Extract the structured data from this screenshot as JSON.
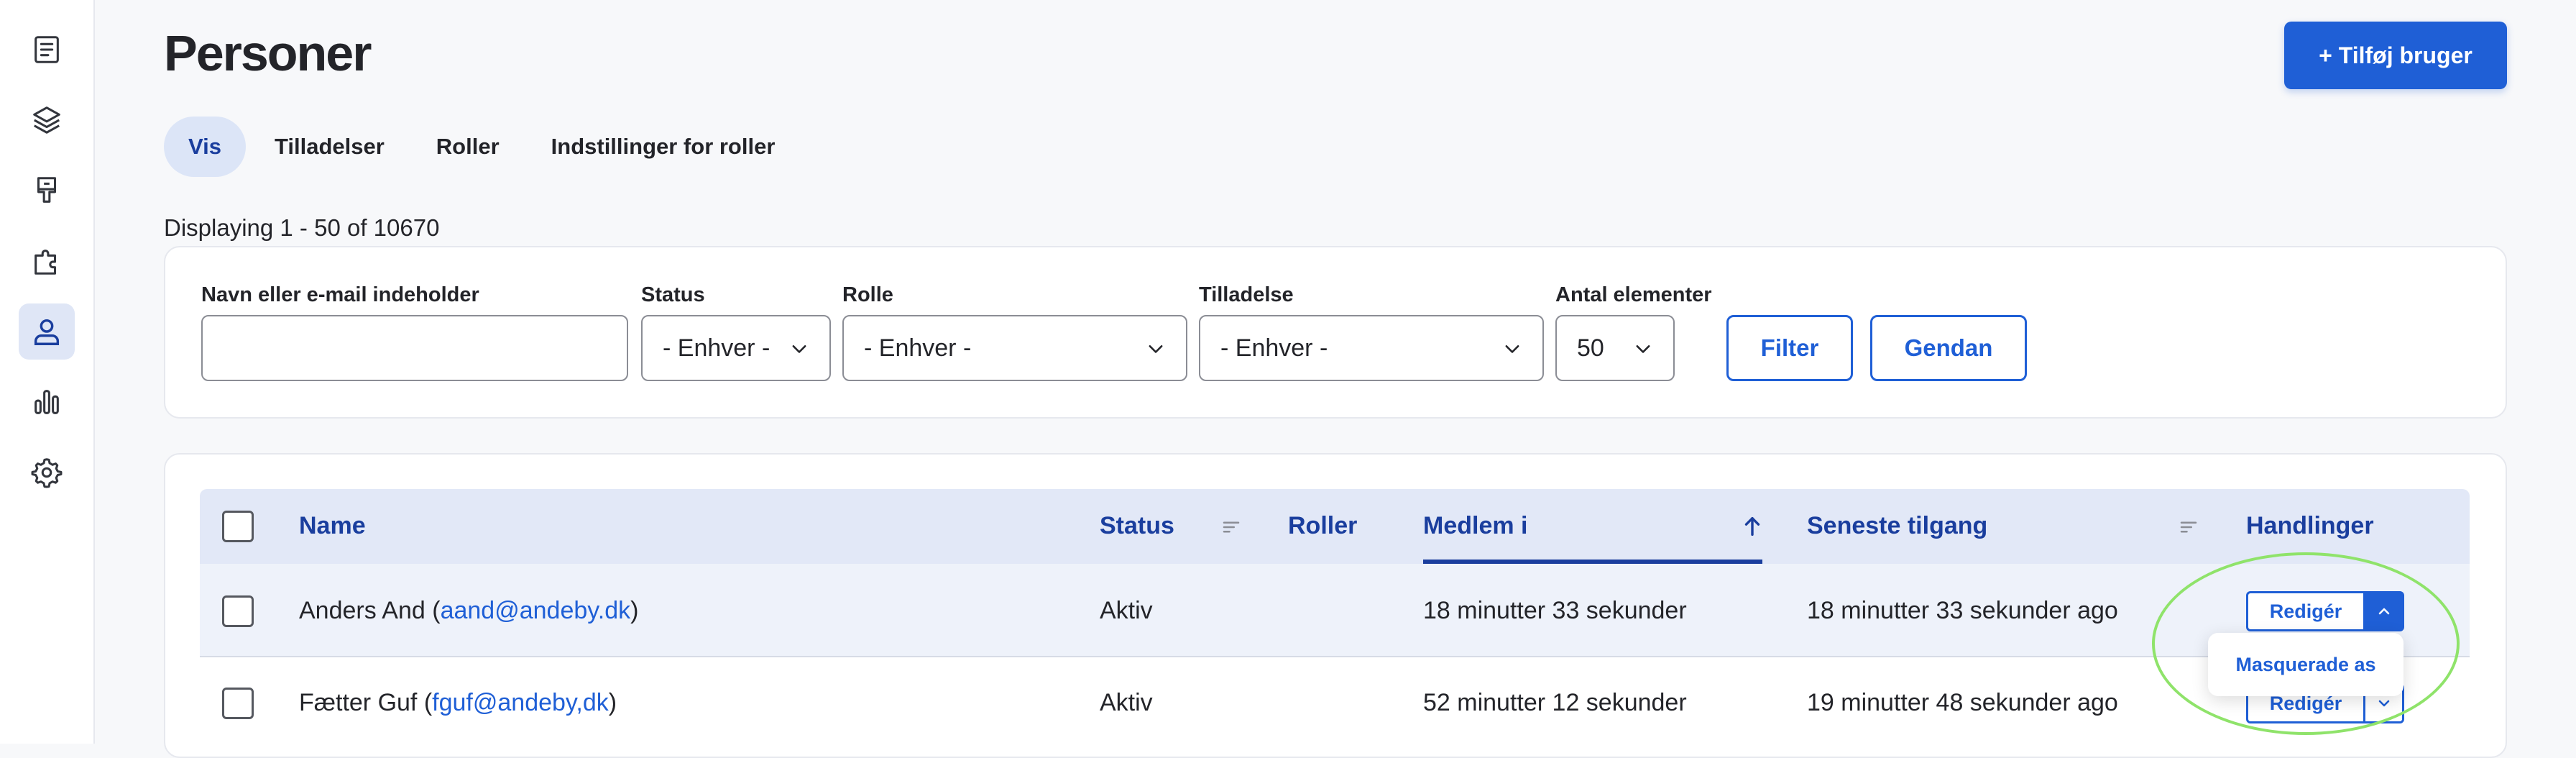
{
  "sidebar": {
    "items": [
      {
        "icon": "document-icon",
        "active": false
      },
      {
        "icon": "layers-icon",
        "active": false
      },
      {
        "icon": "brush-icon",
        "active": false
      },
      {
        "icon": "puzzle-icon",
        "active": false
      },
      {
        "icon": "user-icon",
        "active": true
      },
      {
        "icon": "bar-chart-icon",
        "active": false
      },
      {
        "icon": "gear-icon",
        "active": false
      }
    ]
  },
  "header": {
    "title": "Personer",
    "add_user_label": "+ Tilføj bruger"
  },
  "tabs": [
    {
      "label": "Vis",
      "active": true
    },
    {
      "label": "Tilladelser",
      "active": false
    },
    {
      "label": "Roller",
      "active": false
    },
    {
      "label": "Indstillinger for roller",
      "active": false
    }
  ],
  "displaying": "Displaying 1 - 50 of 10670",
  "filters": {
    "name_label": "Navn eller e-mail indeholder",
    "name_value": "",
    "status_label": "Status",
    "status_value": "- Enhver -",
    "role_label": "Rolle",
    "role_value": "- Enhver -",
    "permission_label": "Tilladelse",
    "permission_value": "- Enhver -",
    "count_label": "Antal elementer",
    "count_value": "50",
    "filter_button": "Filter",
    "reset_button": "Gendan"
  },
  "table": {
    "columns": {
      "name": "Name",
      "status": "Status",
      "roles": "Roller",
      "member": "Medlem i",
      "last_access": "Seneste tilgang",
      "actions": "Handlinger"
    },
    "rows": [
      {
        "name": "Anders And",
        "email": "aand@andeby.dk",
        "status": "Aktiv",
        "member": "18 minutter 33 sekunder",
        "last_access": "18 minutter 33 sekunder ago",
        "edit_label": "Redigér"
      },
      {
        "name": "Fætter Guf",
        "email": "fguf@andeby,dk",
        "status": "Aktiv",
        "member": "52 minutter 12 sekunder",
        "last_access": "19 minutter 48 sekunder ago",
        "edit_label": "Redigér"
      }
    ],
    "dropdown_item": "Masquerade as"
  },
  "colors": {
    "accent": "#1f5fd6",
    "header_bg": "#e2e8f7",
    "highlight": "#8fe36a"
  }
}
